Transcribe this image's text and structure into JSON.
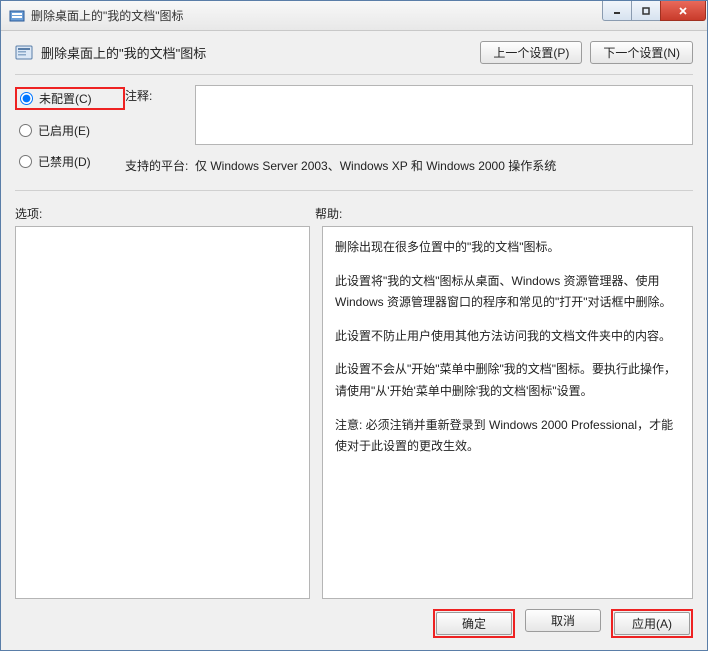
{
  "window": {
    "title": "删除桌面上的\"我的文档\"图标"
  },
  "header": {
    "title": "删除桌面上的\"我的文档\"图标",
    "prev_btn": "上一个设置(P)",
    "next_btn": "下一个设置(N)"
  },
  "radios": {
    "not_configured": "未配置(C)",
    "enabled": "已启用(E)",
    "disabled": "已禁用(D)",
    "selected": "not_configured"
  },
  "fields": {
    "comment_label": "注释:",
    "comment_value": "",
    "platform_label": "支持的平台:",
    "platform_value": "仅 Windows Server 2003、Windows XP 和 Windows 2000 操作系统"
  },
  "section_labels": {
    "options": "选项:",
    "help": "帮助:"
  },
  "help": {
    "p1": "删除出现在很多位置中的\"我的文档\"图标。",
    "p2": "此设置将\"我的文档\"图标从桌面、Windows 资源管理器、使用 Windows 资源管理器窗口的程序和常见的\"打开\"对话框中删除。",
    "p3": "此设置不防止用户使用其他方法访问我的文档文件夹中的内容。",
    "p4": "此设置不会从\"开始\"菜单中删除\"我的文档\"图标。要执行此操作，请使用\"从'开始'菜单中删除'我的文档'图标\"设置。",
    "p5": "注意: 必须注销并重新登录到 Windows 2000 Professional，才能使对于此设置的更改生效。"
  },
  "footer": {
    "ok": "确定",
    "cancel": "取消",
    "apply": "应用(A)"
  }
}
